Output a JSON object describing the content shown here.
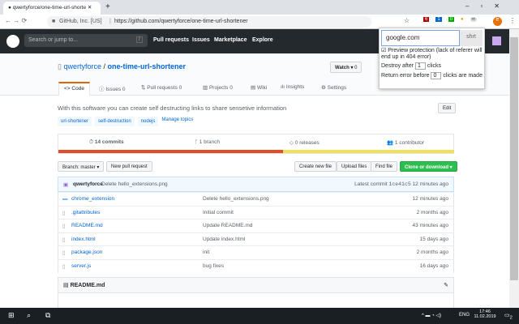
{
  "browser": {
    "tab_title": "qwertyforce/one-time-url-shorte",
    "site_identity": "GitHub, Inc. [US]",
    "url": "https://github.com/qwertyforce/one-time-url-shortener",
    "ext_badges": [
      "6",
      "1",
      "0"
    ],
    "profile_initial": "e"
  },
  "header": {
    "search_placeholder": "Search or jump to...",
    "slash": "/",
    "nav": [
      "Pull requests",
      "Issues",
      "Marketplace",
      "Explore"
    ]
  },
  "repo": {
    "owner": "qwertyforce",
    "sep": "/",
    "name": "one-time-url-shortener",
    "watch_label": "Watch ▾",
    "watch_count": "0",
    "tabs": [
      {
        "label": "Code",
        "count": ""
      },
      {
        "label": "Issues",
        "count": "0"
      },
      {
        "label": "Pull requests",
        "count": "0"
      },
      {
        "label": "Projects",
        "count": "0"
      },
      {
        "label": "Wiki",
        "count": ""
      },
      {
        "label": "Insights",
        "count": ""
      },
      {
        "label": "Settings",
        "count": ""
      }
    ],
    "description": "With this software you can create self destructing links to share sensetive information",
    "edit": "Edit",
    "topics": [
      "url-shortener",
      "self-destruction",
      "nodejs"
    ],
    "manage_topics": "Manage topics",
    "stats": [
      "14 commits",
      "1 branch",
      "0 releases",
      "1 contributor"
    ],
    "branch": "Branch: master ▾",
    "new_pr": "New pull request",
    "create_file": "Create new file",
    "upload": "Upload files",
    "find": "Find file",
    "clone": "Clone or download ▾",
    "commit_author": "qwertyforce",
    "commit_msg": "Delete hello_extensions.png",
    "latest_commit": "Latest commit",
    "sha": "1ce41c5",
    "commit_time": "12 minutes ago",
    "files": [
      {
        "name": "chrome_extension",
        "type": "dir",
        "msg": "Delete hello_extensions.png",
        "age": "12 minutes ago"
      },
      {
        "name": ".gitattributes",
        "type": "file",
        "msg": "Initial commit",
        "age": "2 months ago"
      },
      {
        "name": "README.md",
        "type": "file",
        "msg": "Update README.md",
        "age": "43 minutes ago"
      },
      {
        "name": "index.html",
        "type": "file",
        "msg": "Update index.html",
        "age": "15 days ago"
      },
      {
        "name": "package.json",
        "type": "file",
        "msg": "init",
        "age": "2 months ago"
      },
      {
        "name": "server.js",
        "type": "file",
        "msg": "bug fixes",
        "age": "16 days ago"
      }
    ],
    "readme_title": "README.md"
  },
  "popup": {
    "url_value": "google.com",
    "shrt": "shrt",
    "preview": "Preview protection (lack of referer will end up in 404 error)",
    "destroy_pre": "Destroy after",
    "destroy_val": "1",
    "destroy_post": "clicks",
    "return_pre": "Return error before",
    "return_val": "0",
    "return_post": "clicks are made"
  },
  "taskbar": {
    "lang": "ENG",
    "time": "17:46",
    "date": "11.02.2019",
    "notif": "2"
  }
}
